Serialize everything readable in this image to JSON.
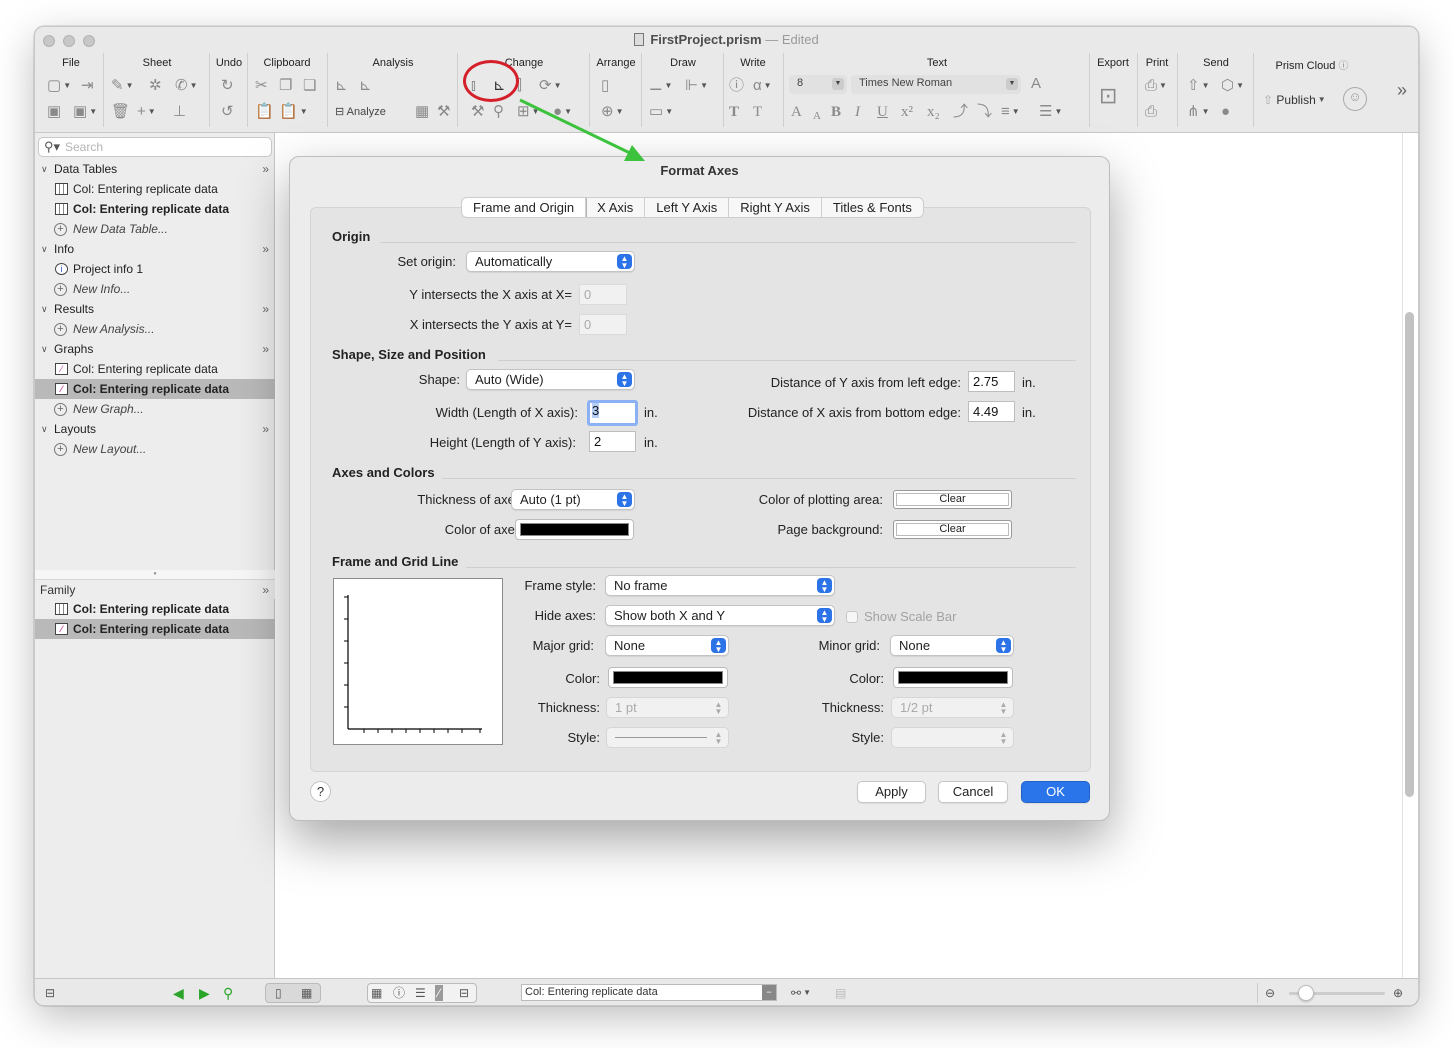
{
  "window": {
    "title": "FirstProject.prism",
    "title_sep": " — ",
    "edited": "Edited"
  },
  "toolbar": {
    "groups": {
      "file": "File",
      "sheet": "Sheet",
      "undo": "Undo",
      "clipboard": "Clipboard",
      "analysis": "Analysis",
      "change": "Change",
      "arrange": "Arrange",
      "draw": "Draw",
      "write": "Write",
      "text": "Text",
      "export": "Export",
      "print": "Print",
      "send": "Send",
      "prism_cloud": "Prism Cloud"
    },
    "analyze_label": "Analyze",
    "publish_label": "Publish",
    "font_size": "8",
    "font_name": "Times New Roman"
  },
  "sidebar": {
    "search_placeholder": "Search",
    "sections": {
      "data_tables": "Data Tables",
      "info": "Info",
      "results": "Results",
      "graphs": "Graphs",
      "layouts": "Layouts"
    },
    "items": {
      "dt1": "Col: Entering replicate data",
      "dt2": "Col: Entering replicate data",
      "new_dt": "New Data Table...",
      "info1": "Project info 1",
      "new_info": "New Info...",
      "new_analysis": "New Analysis...",
      "g1": "Col: Entering replicate data",
      "g2": "Col: Entering replicate data",
      "new_graph": "New Graph...",
      "new_layout": "New Layout..."
    },
    "family": {
      "title": "Family",
      "f1": "Col: Entering replicate data",
      "f2": "Col: Entering replicate data"
    }
  },
  "statusbar": {
    "sheet_select": "Col: Entering replicate data"
  },
  "dialog": {
    "title": "Format Axes",
    "tabs": [
      "Frame and Origin",
      "X Axis",
      "Left Y Axis",
      "Right Y Axis",
      "Titles & Fonts"
    ],
    "origin": {
      "title": "Origin",
      "set_origin_label": "Set origin:",
      "set_origin_value": "Automatically",
      "y_intersects_label": "Y intersects the X axis at X=",
      "y_intersects_value": "0",
      "x_intersects_label": "X intersects the Y axis at Y=",
      "x_intersects_value": "0"
    },
    "shape": {
      "title": "Shape, Size and Position",
      "shape_label": "Shape:",
      "shape_value": "Auto (Wide)",
      "width_label": "Width (Length of X axis):",
      "width_value": "3",
      "height_label": "Height (Length of Y axis):",
      "height_value": "2",
      "unit": "in.",
      "dist_y_label": "Distance of Y axis from left  edge:",
      "dist_y_value": "2.75",
      "dist_x_label": "Distance of X axis from bottom edge:",
      "dist_x_value": "4.49"
    },
    "axes_colors": {
      "title": "Axes and Colors",
      "thickness_label": "Thickness of axes:",
      "thickness_value": "Auto (1 pt)",
      "color_label": "Color of axes:",
      "plot_area_label": "Color of plotting area:",
      "plot_area_value": "Clear",
      "page_bg_label": "Page background:",
      "page_bg_value": "Clear"
    },
    "frame_grid": {
      "title": "Frame and Grid Line",
      "frame_style_label": "Frame style:",
      "frame_style_value": "No frame",
      "hide_axes_label": "Hide axes:",
      "hide_axes_value": "Show both X and Y",
      "scale_bar_label": "Show Scale Bar",
      "major_grid_label": "Major grid:",
      "major_grid_value": "None",
      "minor_grid_label": "Minor grid:",
      "minor_grid_value": "None",
      "color_label": "Color:",
      "thickness_label": "Thickness:",
      "major_thickness_value": "1 pt",
      "minor_thickness_value": "1/2 pt",
      "style_label": "Style:"
    },
    "buttons": {
      "help": "?",
      "apply": "Apply",
      "cancel": "Cancel",
      "ok": "OK"
    }
  },
  "colors": {
    "accent": "#2b75ea",
    "annotation_red": "#d4202a",
    "annotation_green": "#3cc23c",
    "axes_color": "#000000"
  }
}
